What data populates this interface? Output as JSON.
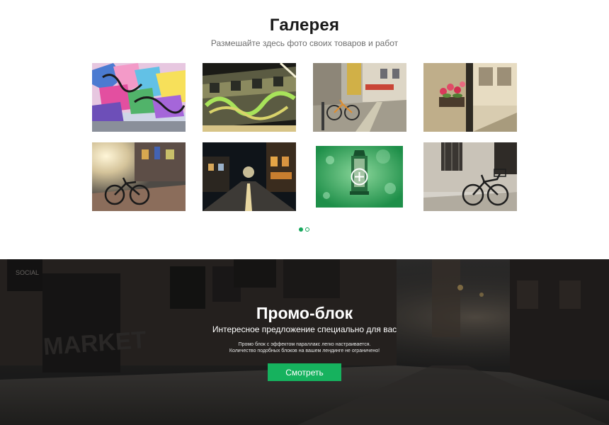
{
  "gallery": {
    "title": "Галерея",
    "subtitle": "Размешайте здесь фото своих товаров и работ",
    "items": [
      {
        "name": "gallery-photo-graffiti-wall"
      },
      {
        "name": "gallery-photo-graffiti-train"
      },
      {
        "name": "gallery-photo-street-bicycle"
      },
      {
        "name": "gallery-photo-flower-window"
      },
      {
        "name": "gallery-photo-bicycle-sunset"
      },
      {
        "name": "gallery-photo-night-street"
      },
      {
        "name": "gallery-photo-green-lantern",
        "hover_icon": "plus-circle-icon"
      },
      {
        "name": "gallery-photo-bicycle-wall"
      }
    ],
    "pagination": {
      "pages": 2,
      "current": 1
    }
  },
  "promo": {
    "title": "Промо-блок",
    "subtitle": "Интересное предложение специально для вас",
    "text_line_1": "Промо блок с эффектом параллакс легко настраивается.",
    "text_line_2": "Количество подобных блоков на вашем лендинге не ограничено!",
    "button_label": "Смотреть",
    "background_signs": {
      "sign_1": "SOCIAL",
      "sign_2": "MARKET"
    }
  },
  "colors": {
    "accent": "#16b25e",
    "title": "#1a1a1a",
    "subtitle": "#6f6f6f"
  }
}
